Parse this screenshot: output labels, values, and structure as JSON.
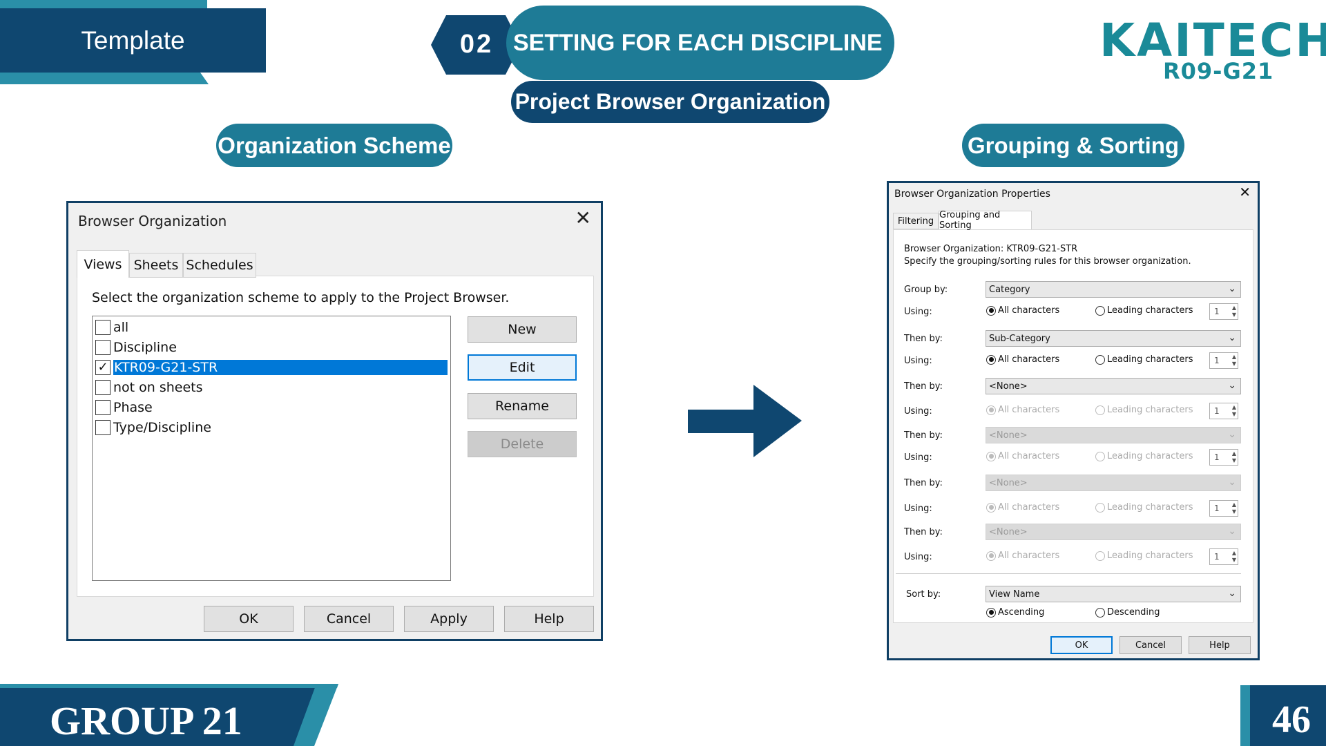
{
  "header": {
    "template_label": "Template",
    "section_number": "02",
    "section_title": "SETTING FOR EACH DISCIPLINE",
    "subtitle": "Project Browser Organization",
    "logo_word": "KAITECH",
    "logo_code": "R09-G21"
  },
  "headings": {
    "left": "Organization Scheme",
    "right": "Grouping & Sorting"
  },
  "colors": {
    "dark_navy": "#0f3f64",
    "teal": "#1e7b96",
    "light_teal": "#2a8fa8",
    "logo": "#1a8a98",
    "selection": "#0078d7"
  },
  "icons": {
    "close": "close-icon",
    "arrow": "right-arrow-icon",
    "check": "checkmark-icon",
    "chevron": "chevron-down-icon"
  },
  "browser_org": {
    "title": "Browser Organization",
    "tabs": [
      "Views",
      "Sheets",
      "Schedules"
    ],
    "instruction": "Select the organization scheme to apply to the Project Browser.",
    "items": [
      {
        "label": "all",
        "checked": false
      },
      {
        "label": "Discipline",
        "checked": false
      },
      {
        "label": "KTR09-G21-STR",
        "checked": true,
        "selected": true
      },
      {
        "label": "not on sheets",
        "checked": false
      },
      {
        "label": "Phase",
        "checked": false
      },
      {
        "label": "Type/Discipline",
        "checked": false
      }
    ],
    "side_buttons": [
      "New",
      "Edit",
      "Rename",
      "Delete"
    ],
    "bottom_buttons": [
      "OK",
      "Cancel",
      "Apply",
      "Help"
    ]
  },
  "props": {
    "title": "Browser Organization Properties",
    "tabs": [
      "Filtering",
      "Grouping and Sorting"
    ],
    "org_line": "Browser Organization: KTR09-G21-STR",
    "desc_line": "Specify the grouping/sorting rules for this browser organization.",
    "group_by_label": "Group by:",
    "then_by_label": "Then by:",
    "using_label": "Using:",
    "all_chars": "All characters",
    "leading_chars": "Leading characters",
    "spin_value": "1",
    "groups": [
      {
        "label": "Group by:",
        "value": "Category",
        "enabled": true
      },
      {
        "label": "Then by:",
        "value": "Sub-Category",
        "enabled": true
      },
      {
        "label": "Then by:",
        "value": "<None>",
        "enabled": true
      },
      {
        "label": "Then by:",
        "value": "<None>",
        "enabled": false
      },
      {
        "label": "Then by:",
        "value": "<None>",
        "enabled": false
      },
      {
        "label": "Then by:",
        "value": "<None>",
        "enabled": false
      }
    ],
    "sort_by_label": "Sort by:",
    "sort_by_value": "View Name",
    "ascending": "Ascending",
    "descending": "Descending",
    "buttons": [
      "OK",
      "Cancel",
      "Help"
    ]
  },
  "footer": {
    "group_label": "GROUP 21",
    "page_number": "46"
  }
}
